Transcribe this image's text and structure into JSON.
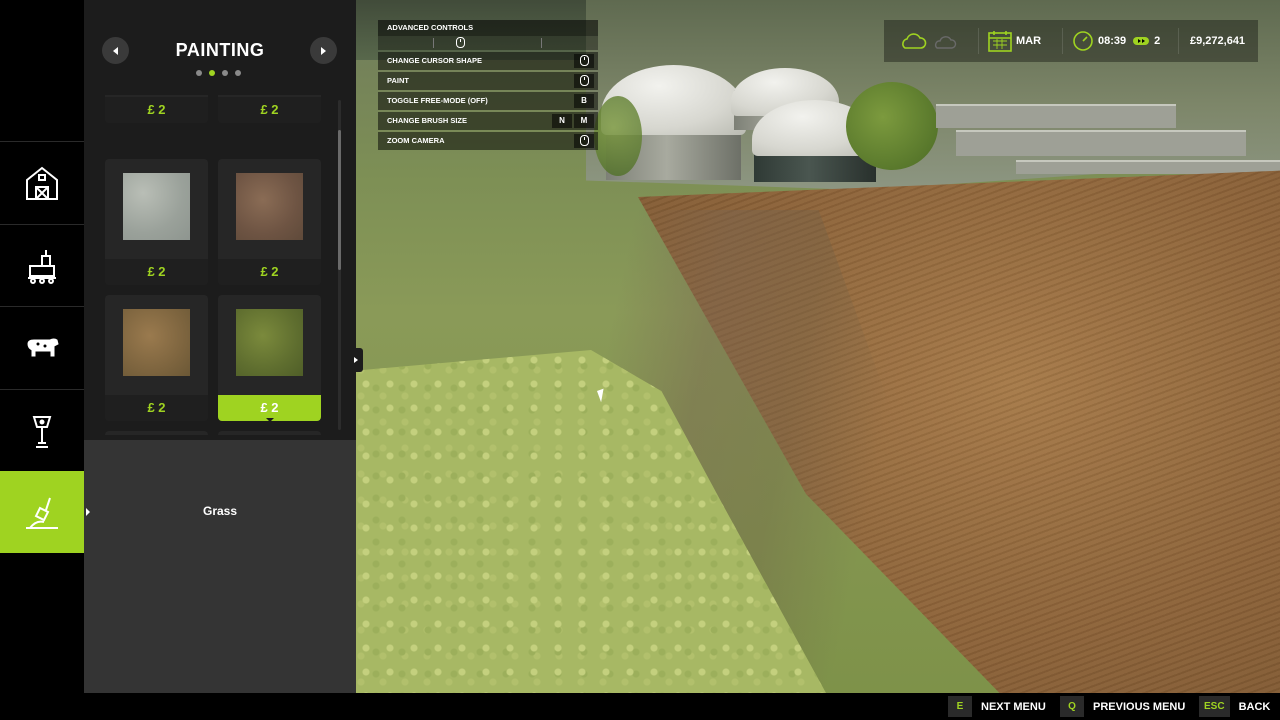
{
  "colors": {
    "accent": "#9fd321",
    "panel_bg": "#1c1c1c",
    "rail_bg": "#000000"
  },
  "rail": {
    "items": [
      {
        "icon": "barn-icon"
      },
      {
        "icon": "production-icon"
      },
      {
        "icon": "cow-icon"
      },
      {
        "icon": "lamp-post-icon"
      },
      {
        "icon": "shovel-icon",
        "active": true
      }
    ]
  },
  "panel": {
    "title": "PAINTING",
    "page_dots": 4,
    "active_dot": 2,
    "tiles": [
      {
        "price": "£ 2"
      },
      {
        "price": "£ 2"
      },
      {
        "price": "£ 2",
        "texture": "concrete"
      },
      {
        "price": "£ 2",
        "texture": "dirt"
      },
      {
        "price": "£ 2",
        "texture": "gravel-dirt"
      },
      {
        "price": "£ 2",
        "texture": "grass",
        "selected": true
      }
    ],
    "detail_name": "Grass"
  },
  "controls": {
    "header": "ADVANCED CONTROLS",
    "rows": [
      {
        "label": "CHANGE CURSOR SHAPE",
        "keys": [
          "mouse-icon"
        ]
      },
      {
        "label": "PAINT",
        "keys": [
          "mouse-icon"
        ]
      },
      {
        "label": "TOGGLE FREE-MODE (OFF)",
        "keys": [
          "B"
        ]
      },
      {
        "label": "CHANGE BRUSH SIZE",
        "keys": [
          "N",
          "M"
        ]
      },
      {
        "label": "ZOOM CAMERA",
        "keys": [
          "mouse-icon"
        ]
      }
    ]
  },
  "hud": {
    "weather_icons": [
      "cloud-icon",
      "cloudy-sun-icon"
    ],
    "month": "MAR",
    "time": "08:39",
    "speed": "2",
    "money": "£9,272,641"
  },
  "bottom_bar": [
    {
      "key": "E",
      "label": "NEXT MENU"
    },
    {
      "key": "Q",
      "label": "PREVIOUS MENU"
    },
    {
      "key": "ESC",
      "label": "BACK"
    }
  ]
}
